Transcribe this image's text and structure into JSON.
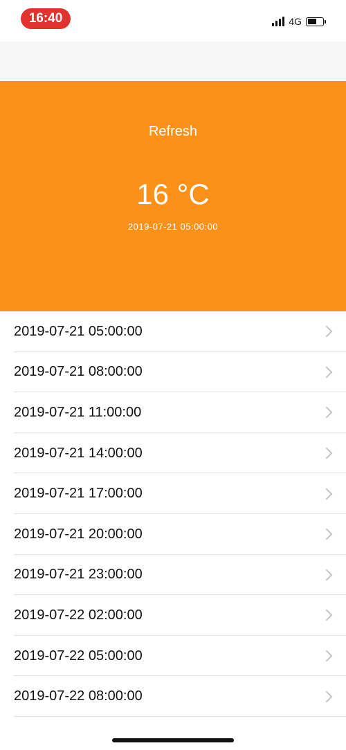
{
  "status_bar": {
    "time": "16:40",
    "network": "4G",
    "battery_level": 0.6,
    "time_pill_color": "#e0322f"
  },
  "header": {
    "refresh_label": "Refresh",
    "temperature": "16 °C",
    "timestamp": "2019-07-21 05:00:00",
    "background_color": "#fc9119"
  },
  "forecast": {
    "items": [
      {
        "label": "2019-07-21 05:00:00"
      },
      {
        "label": "2019-07-21 08:00:00"
      },
      {
        "label": "2019-07-21 11:00:00"
      },
      {
        "label": "2019-07-21 14:00:00"
      },
      {
        "label": "2019-07-21 17:00:00"
      },
      {
        "label": "2019-07-21 20:00:00"
      },
      {
        "label": "2019-07-21 23:00:00"
      },
      {
        "label": "2019-07-22 02:00:00"
      },
      {
        "label": "2019-07-22 05:00:00"
      },
      {
        "label": "2019-07-22 08:00:00"
      }
    ],
    "icon": "chevron-right-icon"
  }
}
